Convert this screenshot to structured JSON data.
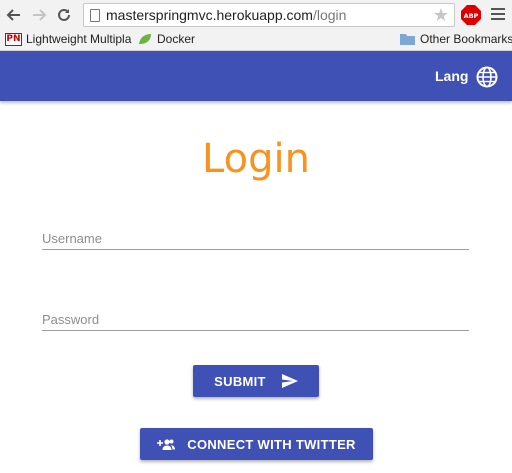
{
  "browser": {
    "url_host": "masterspringmvc.herokuapp.com",
    "url_path": "/login",
    "abp_label": "ABP",
    "bookmarks": [
      {
        "icon": "pn-icon",
        "icon_text": "PN",
        "label": "Lightweight Multipla"
      },
      {
        "icon": "leaf-icon",
        "label": "Docker"
      }
    ],
    "other_bookmarks": "Other Bookmarks"
  },
  "header": {
    "lang_label": "Lang",
    "globe_icon": "globe-icon",
    "bg_color": "#3f51b5"
  },
  "login": {
    "title": "Login",
    "title_color": "#f7931e",
    "username_placeholder": "Username",
    "password_placeholder": "Password",
    "submit_label": "SUBMIT",
    "submit_icon": "send-icon",
    "twitter_label": "CONNECT WITH TWITTER",
    "twitter_icon": "group-add-icon"
  }
}
